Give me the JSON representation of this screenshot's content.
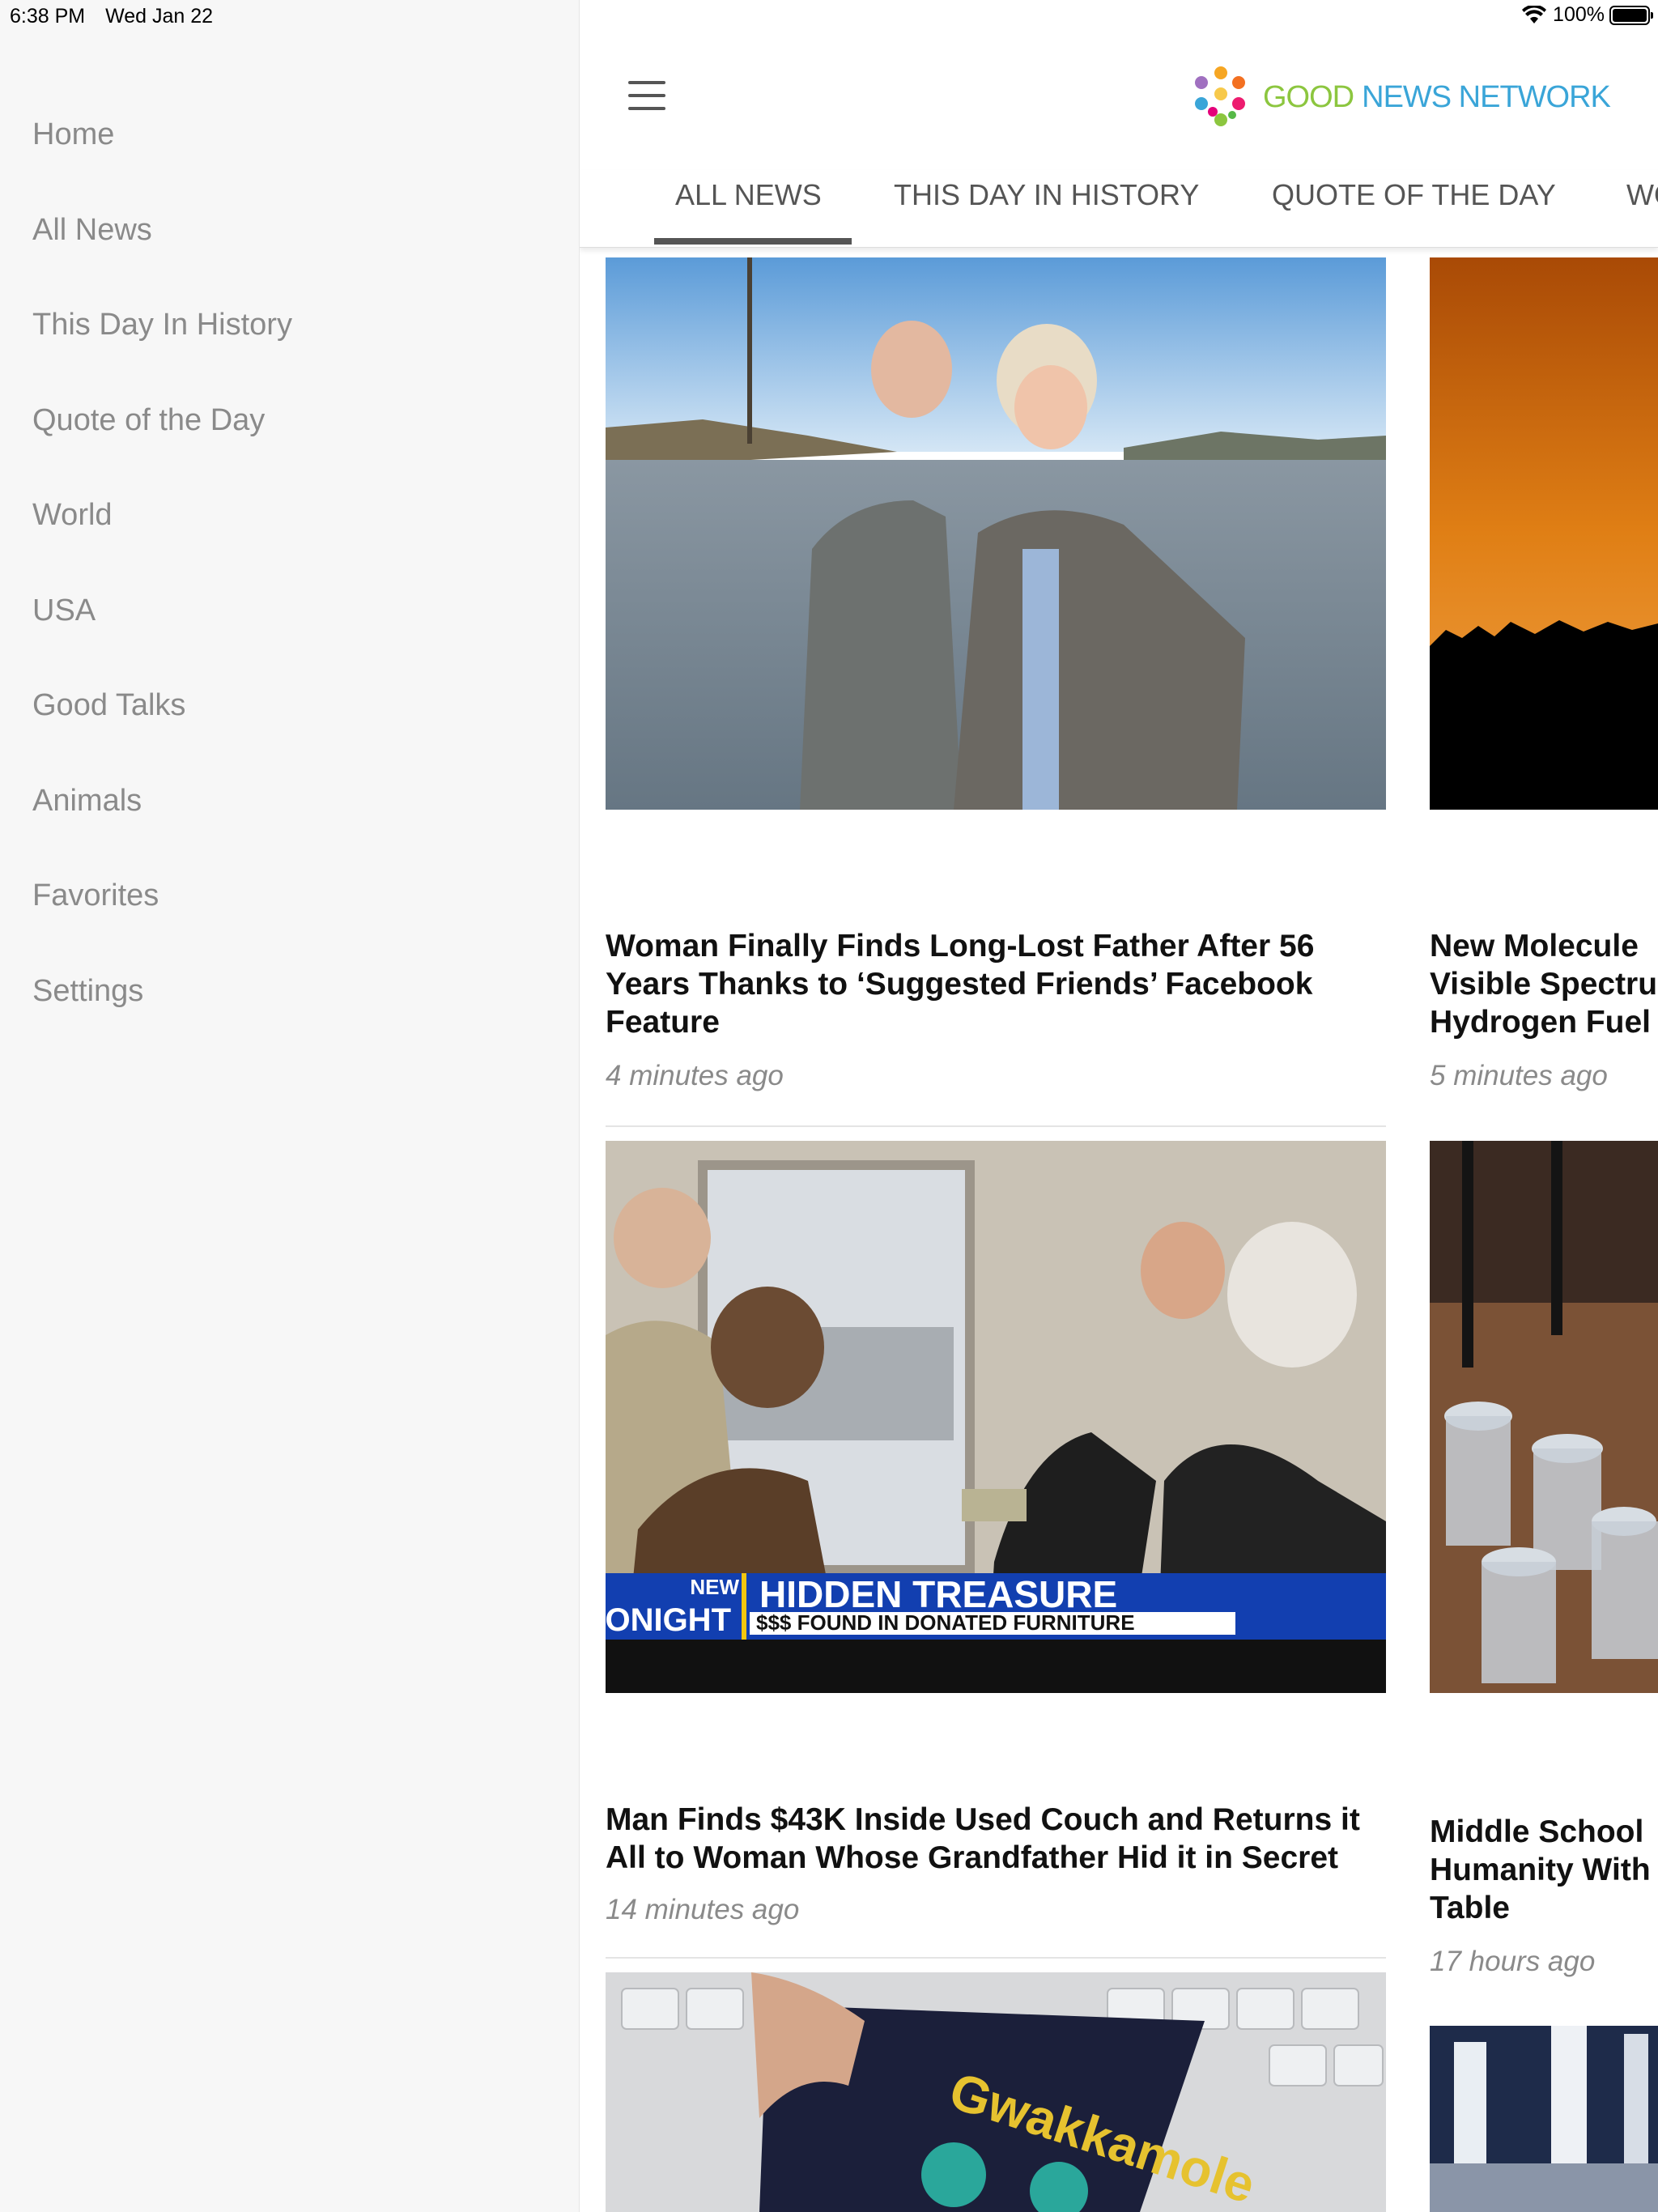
{
  "status_bar": {
    "time": "6:38 PM",
    "date": "Wed Jan 22",
    "battery": "100%"
  },
  "sidebar": {
    "items": [
      {
        "label": "Home"
      },
      {
        "label": "All News"
      },
      {
        "label": "This Day In History"
      },
      {
        "label": "Quote of the Day"
      },
      {
        "label": "World"
      },
      {
        "label": "USA"
      },
      {
        "label": "Good Talks"
      },
      {
        "label": "Animals"
      },
      {
        "label": "Favorites"
      },
      {
        "label": "Settings"
      }
    ]
  },
  "header": {
    "logo_good": "GOOD",
    "logo_rest": "NEWS NETWORK",
    "colors": {
      "green": "#8cc63f",
      "blue": "#3aa5d8"
    }
  },
  "tabs": [
    {
      "label": "ALL NEWS",
      "active": true
    },
    {
      "label": "THIS DAY IN HISTORY"
    },
    {
      "label": "QUOTE OF THE DAY"
    },
    {
      "label": "WO"
    }
  ],
  "articles": [
    {
      "headline": "Woman Finally Finds Long-Lost Father After 56 Years Thanks to ‘Suggested Friends’ Facebook Feature",
      "time": "4 minutes ago"
    },
    {
      "headline": "New Molecule Visible Spectru Hydrogen Fuel",
      "time": "5 minutes ago"
    },
    {
      "headline": "Man Finds $43K Inside Used Couch and Returns it All to Woman Whose Grandfather Hid it in Secret",
      "time": "14 minutes ago",
      "image_caption_tag": "NEW ONIGHT",
      "image_caption_title": "HIDDEN TREASURE",
      "image_caption_sub": "$$$ FOUND IN DONATED FURNITURE"
    },
    {
      "headline": "Middle School Humanity With Table",
      "time": "17 hours ago"
    },
    {
      "image_text": "Gwakkamole"
    }
  ]
}
